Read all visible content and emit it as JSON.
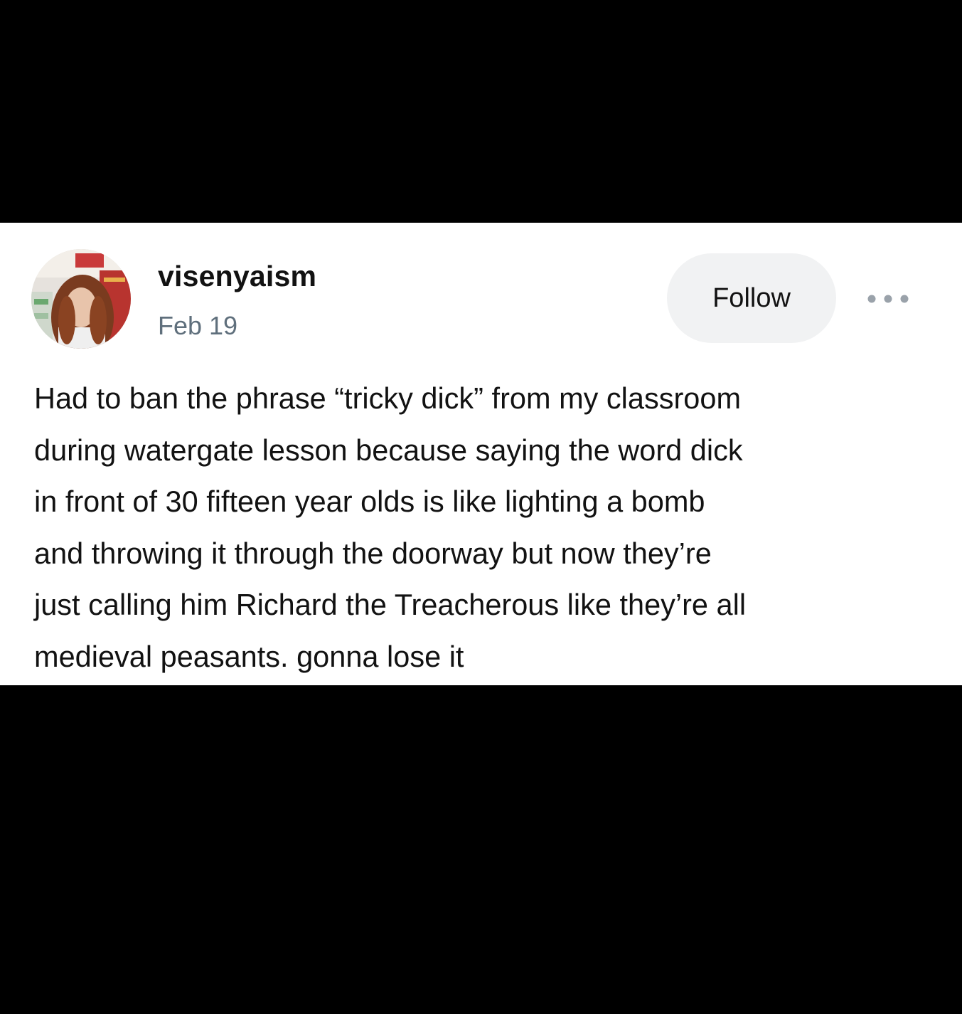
{
  "post": {
    "username": "visenyaism",
    "date": "Feb 19",
    "follow_label": "Follow",
    "more_icon": "more-horizontal-icon",
    "avatar_icon": "user-avatar",
    "body_lines": [
      "Had to ban the phrase “tricky dick” from my classroom",
      "during watergate lesson because saying the word dick",
      "in front of 30 fifteen year olds is like lighting a bomb",
      "and throwing it through the doorway but now they’re",
      "just calling him Richard the Treacherous like they’re all",
      "medieval peasants. gonna lose it"
    ]
  },
  "colors": {
    "background": "#000000",
    "card": "#ffffff",
    "text": "#121212",
    "muted": "#5f6f7c",
    "follow_bg": "#f1f2f3",
    "dots": "#9aa2aa"
  }
}
